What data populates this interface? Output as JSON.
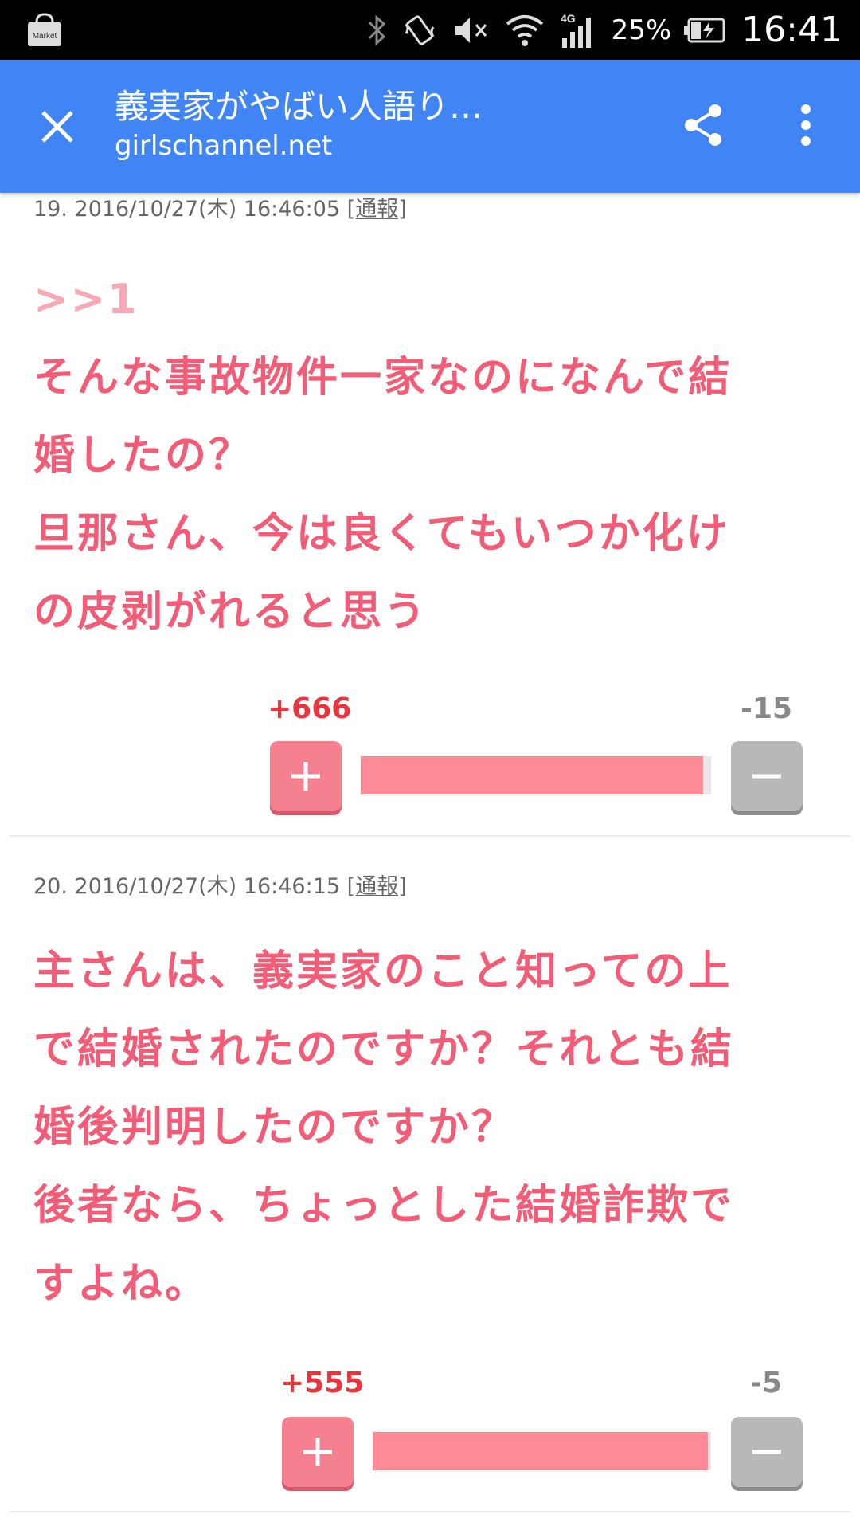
{
  "status_bar": {
    "market_label": "Market",
    "battery_percent": "25%",
    "time": "16:41",
    "network": "4G",
    "icons": [
      "bluetooth-icon",
      "vibrate-icon",
      "mute-icon",
      "wifi-icon",
      "signal-icon",
      "battery-charging-icon"
    ]
  },
  "app_bar": {
    "title": "義実家がやばい人語り…",
    "domain": "girlschannel.net",
    "icons": [
      "close-icon",
      "share-icon",
      "more-vert-icon"
    ]
  },
  "colors": {
    "app_bar": "#4185f4",
    "comment_text": "#f25c76",
    "anchor_text": "#f7a8b6",
    "plus_count": "#e8343c",
    "plus_button": "#f5808f",
    "minus_button": "#b8b8b8",
    "vote_bar": "#ff8a97"
  },
  "comments": [
    {
      "meta": "19.  2016/10/27(木) 16:46:05",
      "report": "[通報]",
      "anchor": ">>1",
      "lines": [
        "そんな事故物件一家なのになんで結",
        "婚したの？",
        "旦那さん、今は良くてもいつか化け",
        "の皮剥がれると思う"
      ],
      "plus": "+666",
      "minus": "-15",
      "plus_share": 0.978
    },
    {
      "meta": "20.  2016/10/27(木) 16:46:15",
      "report": "[通報]",
      "anchor": "",
      "lines": [
        "主さんは、義実家のこと知っての上",
        "で結婚されたのですか？それとも結",
        "婚後判明したのですか？",
        "後者なら、ちょっとした結婚詐欺で",
        "すよね。"
      ],
      "plus": "+555",
      "minus": "-5",
      "plus_share": 0.991
    }
  ]
}
